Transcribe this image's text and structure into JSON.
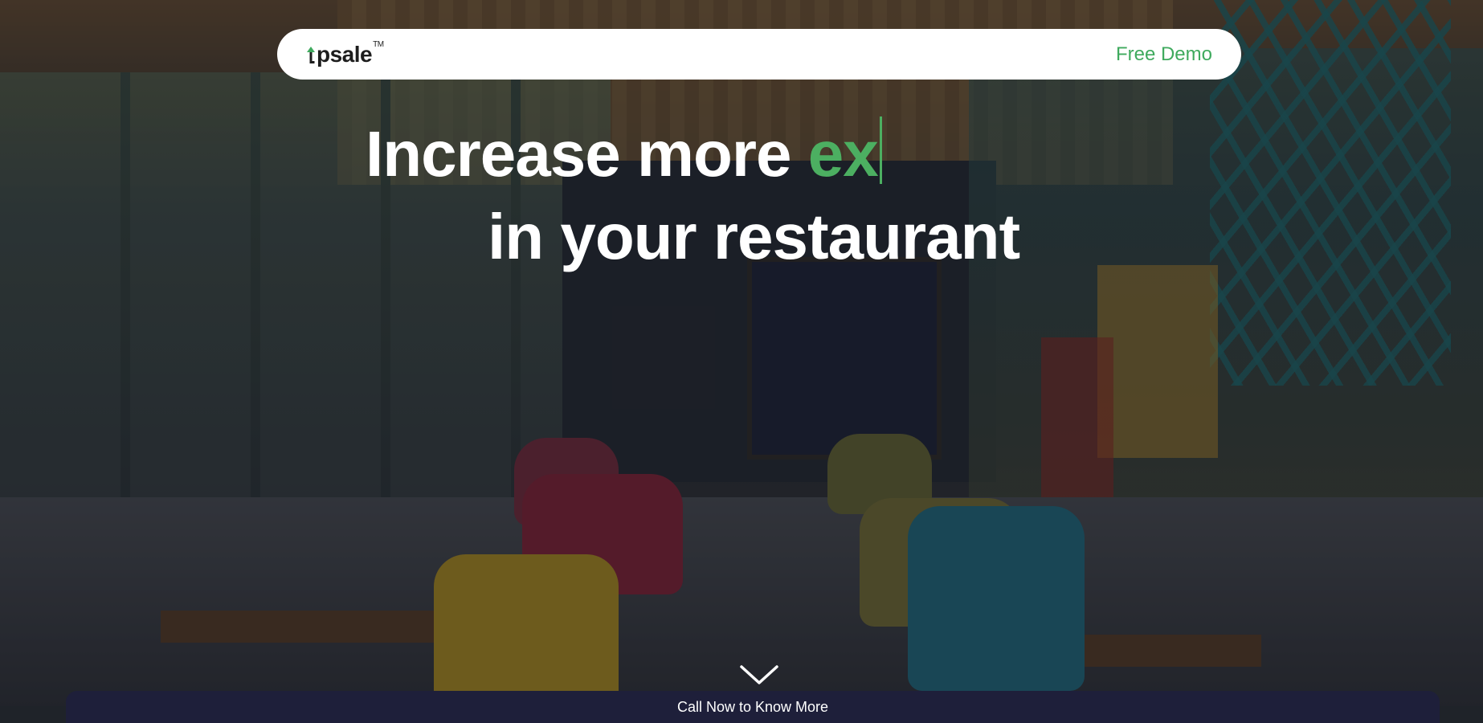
{
  "header": {
    "logo_text": "psale",
    "logo_trademark": "TM",
    "cta_label": "Free Demo"
  },
  "hero": {
    "line1_prefix": "Increase more ",
    "line1_typed": "ex",
    "line2": "in your restaurant"
  },
  "bottom_bar": {
    "label": "Call Now to Know More"
  },
  "colors": {
    "accent_green": "#4caf61",
    "navbar_bg": "#ffffff",
    "bottom_bar_bg": "#1e1f3a"
  },
  "icons": {
    "scroll": "chevron-down-icon",
    "logo_mark": "arrow-up-icon"
  }
}
